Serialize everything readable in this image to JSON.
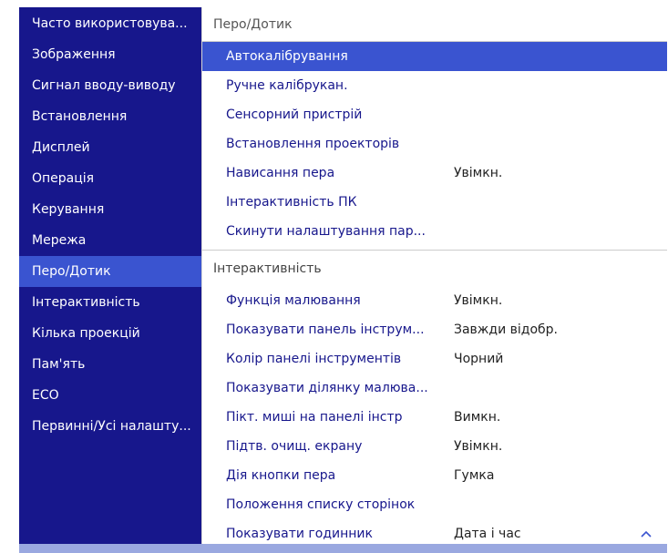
{
  "sidebar": {
    "items": [
      {
        "label": "Часто використовува..."
      },
      {
        "label": "Зображення"
      },
      {
        "label": "Сигнал вводу-виводу"
      },
      {
        "label": "Встановлення"
      },
      {
        "label": "Дисплей"
      },
      {
        "label": "Операція"
      },
      {
        "label": "Керування"
      },
      {
        "label": "Мережа"
      },
      {
        "label": "Перо/Дотик",
        "active": true
      },
      {
        "label": "Інтерактивність"
      },
      {
        "label": "Кілька проекцій"
      },
      {
        "label": "Пам'ять"
      },
      {
        "label": "ECO"
      },
      {
        "label": "Первинні/Усі налашту..."
      }
    ]
  },
  "main": {
    "section1_title": "Перо/Дотик",
    "section1_items": [
      {
        "label": "Автокалібрування",
        "value": "",
        "selected": true
      },
      {
        "label": "Ручне калібрукан.",
        "value": ""
      },
      {
        "label": "Сенсорний пристрій",
        "value": ""
      },
      {
        "label": "Встановлення проекторів",
        "value": ""
      },
      {
        "label": "Нависання пера",
        "value": "Увімкн."
      },
      {
        "label": "Інтерактивність ПК",
        "value": ""
      },
      {
        "label": "Скинути налаштування пар...",
        "value": ""
      }
    ],
    "section2_title": "Інтерактивність",
    "section2_items": [
      {
        "label": "Функція малювання",
        "value": "Увімкн."
      },
      {
        "label": "Показувати панель інструм...",
        "value": "Завжди відобр."
      },
      {
        "label": "Колір панелі інструментів",
        "value": "Чорний"
      },
      {
        "label": "Показувати ділянку малюва...",
        "value": ""
      },
      {
        "label": "Пікт. миші на панелі інстр",
        "value": "Вимкн."
      },
      {
        "label": "Підтв. очищ. екрану",
        "value": "Увімкн."
      },
      {
        "label": "Дія кнопки пера",
        "value": "Гумка"
      },
      {
        "label": "Положення списку сторінок",
        "value": ""
      },
      {
        "label": "Показувати годинник",
        "value": "Дата і час"
      }
    ]
  },
  "icons": {
    "scroll_up": "chevron-up-icon"
  },
  "colors": {
    "sidebar_bg": "#17178c",
    "highlight": "#3a54d0",
    "item_text": "#17178c"
  }
}
